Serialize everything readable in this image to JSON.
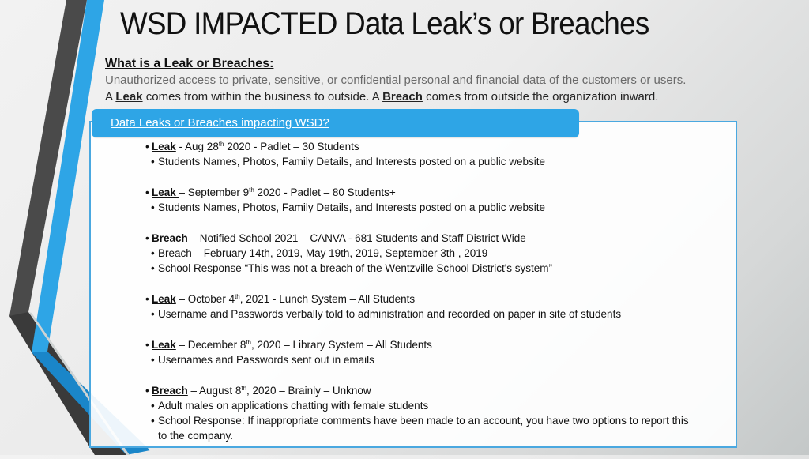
{
  "slide": {
    "title": "WSD IMPACTED Data Leak’s or Breaches",
    "definition": {
      "heading": "What is a Leak or Breaches:",
      "description": "Unauthorized access to private, sensitive, or confidential personal and financial data of the customers or users.",
      "line2_prefix": "A ",
      "leak_word": "Leak",
      "line2_mid": " comes from within the business to outside.  A ",
      "breach_word": "Breach",
      "line2_suffix": " comes from outside the organization inward."
    },
    "panel": {
      "tab_label": "Data Leaks or Breaches impacting WSD?",
      "accent_color": "#2ea5e6",
      "border_color": "#4aa8e0"
    },
    "incidents": [
      {
        "type": "Leak",
        "pre": " - Aug 28",
        "sup": "th",
        "post": " 2020  - Padlet – 30 Students",
        "details": [
          "Students Names, Photos, Family Details, and Interests posted on a public website"
        ]
      },
      {
        "type": "Leak ",
        "pre": "– September 9",
        "sup": "th",
        "post": " 2020 - Padlet – 80 Students+",
        "details": [
          "Students Names, Photos, Family Details, and Interests posted on a public website"
        ]
      },
      {
        "type": "Breach",
        "pre": " – Notified School 2021 – CANVA - 681 Students and Staff District Wide",
        "sup": "",
        "post": "",
        "details": [
          "Breach – February 14th, 2019, May 19th, 2019, September 3th , 2019",
          "School Response “This was not a breach of the Wentzville School District's system”"
        ]
      },
      {
        "type": "Leak",
        "pre": " – October 4",
        "sup": "th",
        "post": ", 2021 - Lunch System – All Students",
        "details": [
          "Username and Passwords verbally told to administration and recorded on paper in site of students"
        ]
      },
      {
        "type": "Leak",
        "pre": " – December 8",
        "sup": "th",
        "post": ", 2020 – Library System – All Students",
        "details": [
          "Usernames and Passwords sent out in emails"
        ]
      },
      {
        "type": "Breach",
        "pre": " – August 8",
        "sup": "th",
        "post": ", 2020 – Brainly – Unknow",
        "details": [
          "Adult males on applications chatting with female students",
          "School Response: If inappropriate comments have been made to an account, you have two options to report this to the company."
        ]
      }
    ]
  }
}
